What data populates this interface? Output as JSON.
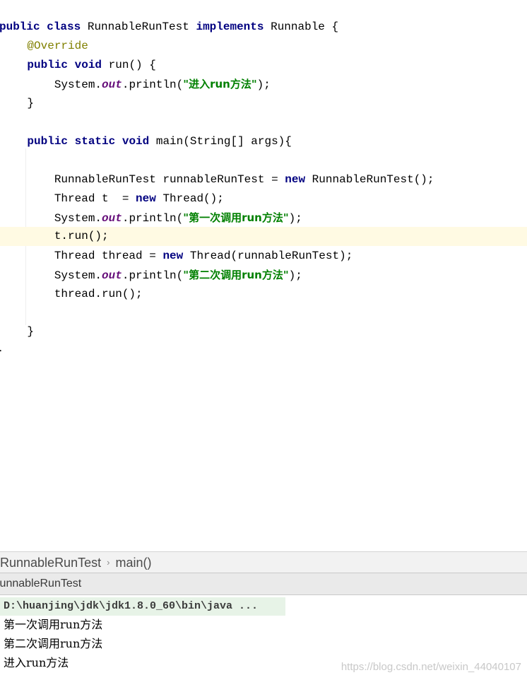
{
  "editor": {
    "code": {
      "l1_public": "public",
      "l1_class": "class",
      "l1_name": " RunnableRunTest ",
      "l1_implements": "implements",
      "l1_rest": " Runnable {",
      "l2_annotation": "@Override",
      "l3_public": "public",
      "l3_void": "void",
      "l3_rest": " run() {",
      "l4_system": "System.",
      "l4_out": "out",
      "l4_println": ".println(",
      "l4_string": "\"进入run方法\"",
      "l4_end": ");",
      "l5_brace": "}",
      "l7_public": "public",
      "l7_static": "static",
      "l7_void": "void",
      "l7_rest": " main(String[] args){",
      "l9_decl": "RunnableRunTest runnableRunTest = ",
      "l9_new": "new",
      "l9_rest": " RunnableRunTest();",
      "l10_decl": "Thread t  = ",
      "l10_new": "new",
      "l10_rest": " Thread();",
      "l11_system": "System.",
      "l11_out": "out",
      "l11_println": ".println(",
      "l11_string": "\"第一次调用run方法\"",
      "l11_end": ");",
      "l12_call": "t.run();",
      "l13_decl": "Thread thread = ",
      "l13_new": "new",
      "l13_rest": " Thread(runnableRunTest);",
      "l14_system": "System.",
      "l14_out": "out",
      "l14_println": ".println(",
      "l14_string": "\"第二次调用run方法\"",
      "l14_end": ");",
      "l15_call": "thread.run();",
      "l17_brace": "}",
      "l18_brace": "}"
    }
  },
  "breadcrumb": {
    "class_name": "RunnableRunTest",
    "separator": "›",
    "method_name": "main()"
  },
  "run_panel": {
    "tab_label": "RunnableRunTest"
  },
  "console": {
    "command": "D:\\huanjing\\jdk\\jdk1.8.0_60\\bin\\java ...",
    "output": [
      "第一次调用run方法",
      "第二次调用run方法",
      "进入run方法"
    ]
  },
  "watermark": "https://blog.csdn.net/weixin_44040107",
  "colors": {
    "keyword": "#000080",
    "annotation": "#808000",
    "static_field": "#660e7a",
    "string": "#008000",
    "current_line": "#fffae3",
    "console_command_bg": "#e7f3e7"
  }
}
